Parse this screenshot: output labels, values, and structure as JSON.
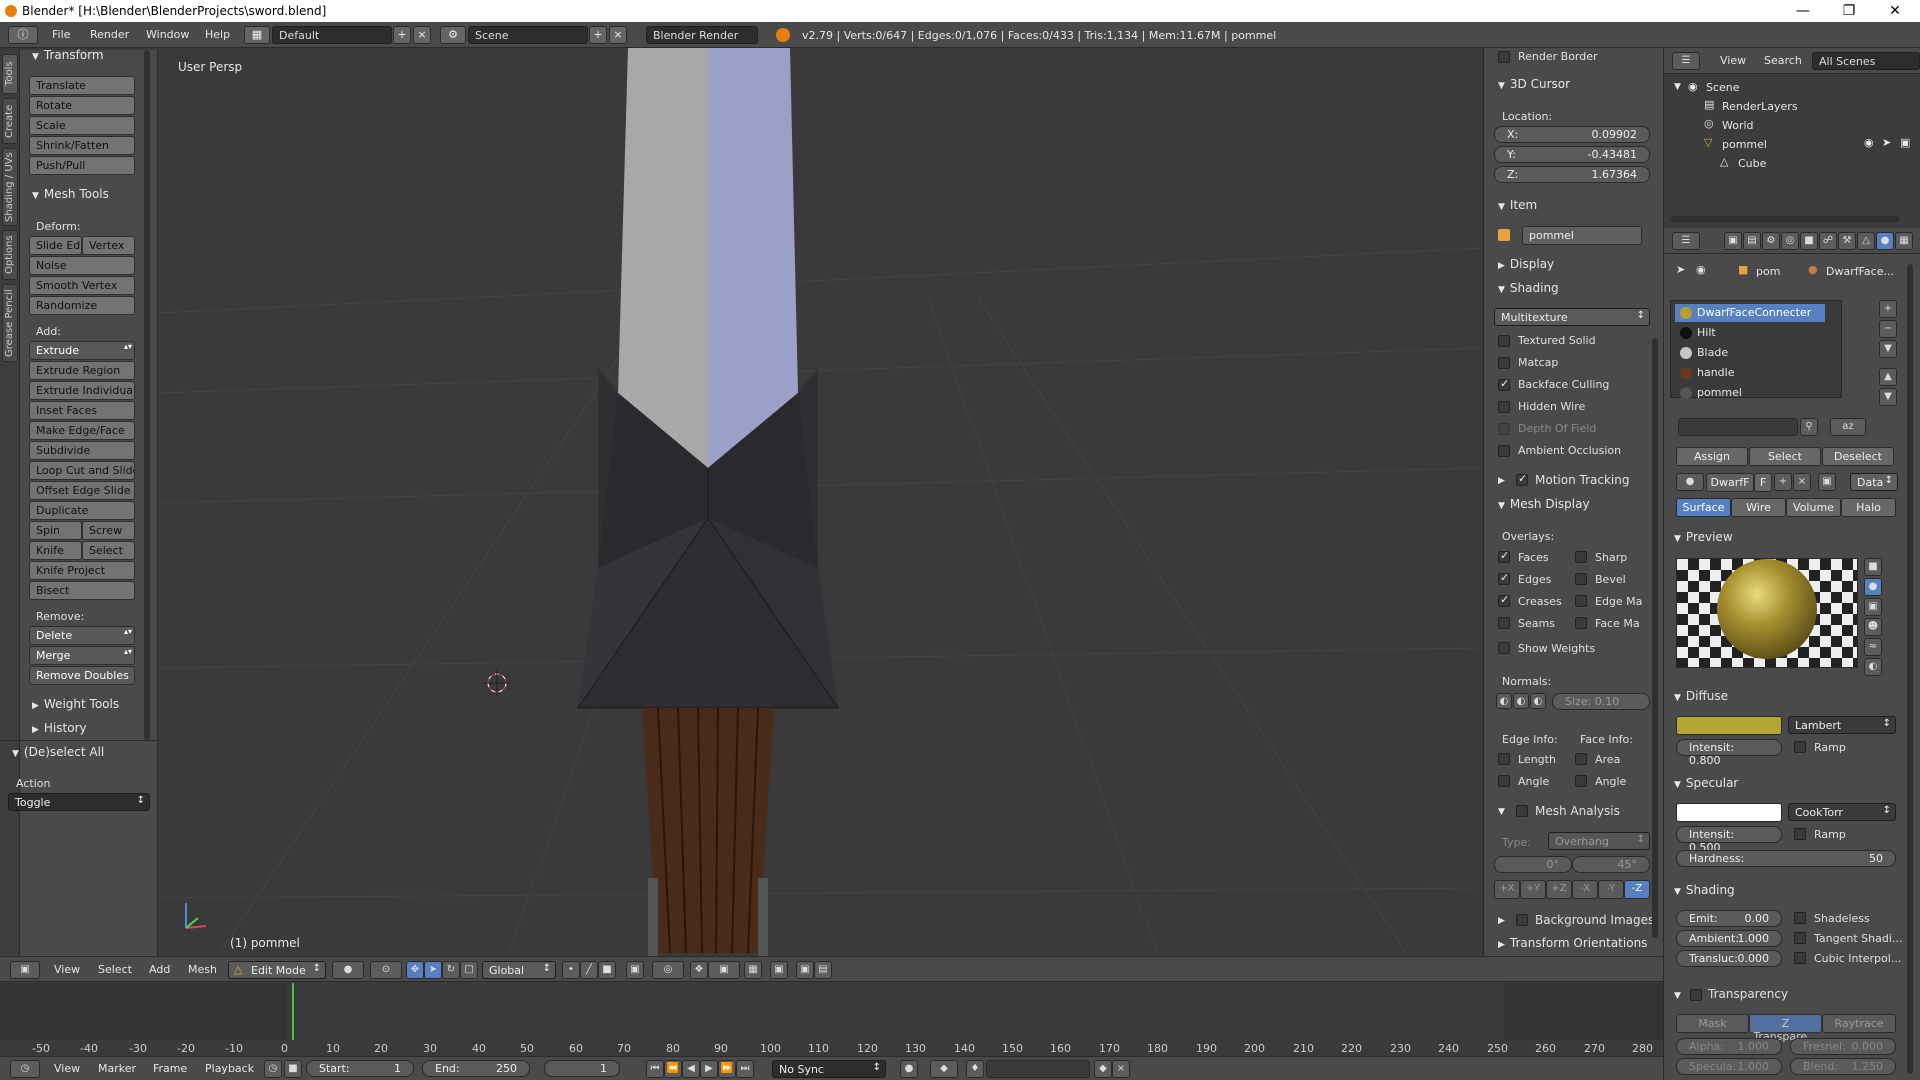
{
  "window": {
    "title": "Blender* [H:\\Blender\\BlenderProjects\\sword.blend]",
    "controls": [
      "—",
      "❐",
      "✕"
    ]
  },
  "infobar": {
    "menus": [
      "File",
      "Render",
      "Window",
      "Help"
    ],
    "layout": "Default",
    "scene": "Scene",
    "engine": "Blender Render",
    "stats": "v2.79 | Verts:0/647 | Edges:0/1,076 | Faces:0/433 | Tris:1,134 | Mem:11.67M | pommel"
  },
  "left_tabs": [
    "Tools",
    "Create",
    "Shading / UVs",
    "Options",
    "Grease Pencil"
  ],
  "toolshelf": {
    "transform_header": "Transform",
    "transform": [
      "Translate",
      "Rotate",
      "Scale",
      "Shrink/Fatten",
      "Push/Pull"
    ],
    "mesh_tools_header": "Mesh Tools",
    "deform_label": "Deform:",
    "deform_row": [
      "Slide Ed",
      "Vertex"
    ],
    "deform": [
      "Noise",
      "Smooth Vertex",
      "Randomize"
    ],
    "add_label": "Add:",
    "extrude": "Extrude",
    "add": [
      "Extrude Region",
      "Extrude Individual",
      "Inset Faces",
      "Make Edge/Face",
      "Subdivide",
      "Loop Cut and Slide",
      "Offset Edge Slide",
      "Duplicate"
    ],
    "spin_row": [
      "Spin",
      "Screw"
    ],
    "knife_row": [
      "Knife",
      "Select"
    ],
    "add2": [
      "Knife Project",
      "Bisect"
    ],
    "remove_label": "Remove:",
    "delete": "Delete",
    "merge": "Merge",
    "remove_doubles": "Remove Doubles",
    "weight_tools": "Weight Tools",
    "history": "History",
    "deselect_all": "(De)select All",
    "action_label": "Action",
    "action_value": "Toggle"
  },
  "viewport": {
    "label": "User Persp",
    "object": "(1) pommel"
  },
  "npanel": {
    "render_border": "Render Border",
    "cursor_header": "3D Cursor",
    "location_label": "Location:",
    "x_label": "X:",
    "x": "0.09902",
    "y_label": "Y:",
    "y": "-0.43481",
    "z_label": "Z:",
    "z": "1.67364",
    "item_header": "Item",
    "item_name": "pommel",
    "display_header": "Display",
    "shading_header": "Shading",
    "shading_mode": "Multitexture",
    "shading_opts": [
      {
        "label": "Textured Solid",
        "on": false
      },
      {
        "label": "Matcap",
        "on": false
      },
      {
        "label": "Backface Culling",
        "on": true
      },
      {
        "label": "Hidden Wire",
        "on": false
      },
      {
        "label": "Depth Of Field",
        "on": false
      },
      {
        "label": "Ambient Occlusion",
        "on": false
      }
    ],
    "motion_tracking": "Motion Tracking",
    "mesh_display_header": "Mesh Display",
    "overlays_label": "Overlays:",
    "overlays_left": [
      "Faces",
      "Edges",
      "Creases",
      "Seams"
    ],
    "overlays_right": [
      "Sharp",
      "Bevel",
      "Edge Ma",
      "Face Ma"
    ],
    "show_weights": "Show Weights",
    "normals_label": "Normals:",
    "normals_size": "Size:  0.10",
    "edge_info": "Edge Info:",
    "face_info": "Face Info:",
    "length": "Length",
    "area": "Area",
    "angle1": "Angle",
    "angle2": "Angle",
    "mesh_analysis": "Mesh Analysis",
    "type_label": "Type:",
    "type_value": "Overhang",
    "ang_min": "0°",
    "ang_max": "45°",
    "axes": [
      "+X",
      "+Y",
      "+Z",
      "-X",
      "-Y",
      "-Z"
    ],
    "background_images": "Background Images",
    "transform_orientations": "Transform Orientations"
  },
  "outliner": {
    "view": "View",
    "search": "Search",
    "filter": "All Scenes",
    "items": [
      "Scene",
      "RenderLayers",
      "World",
      "pommel",
      "Cube"
    ]
  },
  "properties": {
    "breadcrumb": [
      "pom",
      "DwarfFace..."
    ],
    "materials": [
      "DwarfFaceConnecter",
      "Hilt",
      "Blade",
      "handle",
      "pommel"
    ],
    "material_colors": [
      "#b8a030",
      "#111111",
      "#c8c8c8",
      "#6a3820",
      "#555555"
    ],
    "assign": "Assign",
    "select": "Select",
    "deselect": "Deselect",
    "mat_name": "DwarfF",
    "mat_f": "F",
    "data": "Data",
    "tabs": [
      "Surface",
      "Wire",
      "Volume",
      "Halo"
    ],
    "preview": "Preview",
    "diffuse": "Diffuse",
    "diffuse_shader": "Lambert",
    "intensity_label": "Intensit:",
    "diffuse_intensity": "0.800",
    "ramp": "Ramp",
    "diffuse_color": "#b5a532",
    "specular": "Specular",
    "specular_shader": "CookTorr",
    "specular_intensity": "0.500",
    "hardness_label": "Hardness:",
    "hardness": "50",
    "shading": "Shading",
    "emit_label": "Emit:",
    "emit": "0.00",
    "ambient_label": "Ambient:",
    "ambient": "1.000",
    "transluc_label": "Transluc:",
    "transluc": "0.000",
    "shadeless": "Shadeless",
    "tangent": "Tangent Shadi...",
    "cubic": "Cubic Interpol...",
    "transparency": "Transparency",
    "trans_tabs": [
      "Mask",
      "Z Transpare...",
      "Raytrace"
    ],
    "alpha_label": "Alpha:",
    "alpha": "1.000",
    "fresnel_label": "Fresnel:",
    "fresnel": "0.000",
    "specula_label": "Specula:",
    "specula": "1.000",
    "blend_label": "Blend:",
    "blend": "1.250"
  },
  "view_header": {
    "menus": [
      "View",
      "Select",
      "Add",
      "Mesh"
    ],
    "mode": "Edit Mode",
    "orientation": "Global"
  },
  "timeline": {
    "ruler": [
      "-50",
      "-40",
      "-30",
      "-20",
      "-10",
      "0",
      "10",
      "20",
      "30",
      "40",
      "50",
      "60",
      "70",
      "80",
      "90",
      "100",
      "110",
      "120",
      "130",
      "140",
      "150",
      "160",
      "170",
      "180",
      "190",
      "200",
      "210",
      "220",
      "230",
      "240",
      "250",
      "260",
      "270",
      "280"
    ],
    "menus": [
      "View",
      "Marker",
      "Frame",
      "Playback"
    ],
    "start_label": "Start:",
    "start": "1",
    "end_label": "End:",
    "end": "250",
    "current": "1",
    "sync": "No Sync",
    "current_frame": 1
  }
}
